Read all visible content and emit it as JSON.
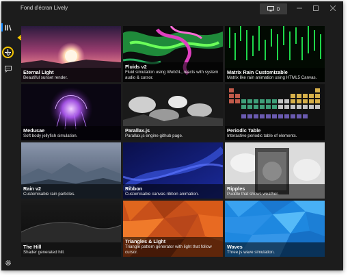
{
  "window": {
    "title": "Fond d'écran Lively",
    "display_button_label": "0",
    "icons": [
      "display-icon",
      "minimize-icon",
      "maximize-icon",
      "close-icon"
    ]
  },
  "sidebar": {
    "items": [
      {
        "name": "library-icon",
        "glyph": "║╲"
      },
      {
        "name": "add-icon",
        "glyph": "+"
      },
      {
        "name": "help-icon",
        "glyph": "?"
      },
      {
        "name": "feedback-icon",
        "glyph": "…"
      },
      {
        "name": "settings-icon",
        "glyph": "⚙"
      }
    ],
    "highlight_color": "#f7c600"
  },
  "wallpapers": [
    {
      "title": "Eternal Light",
      "description": "Beautiful sunset render."
    },
    {
      "title": "Fluids v2",
      "description": "Fluid simulation using WebGL, reacts with system audio & cursor."
    },
    {
      "title": "Matrix Rain Customizable",
      "description": "Matrix like rain animation using HTML5 Canvas."
    },
    {
      "title": "Medusae",
      "description": "Soft body jellyfish simulation."
    },
    {
      "title": "Parallax.js",
      "description": "Parallax.js engine github page."
    },
    {
      "title": "Periodic Table",
      "description": "Interactive periodic table of elements."
    },
    {
      "title": "Rain v2",
      "description": "Customisable rain particles."
    },
    {
      "title": "Ribbon",
      "description": "Customisable canvas ribbon animation."
    },
    {
      "title": "Ripples",
      "description": "Puddle that shows weather."
    },
    {
      "title": "The Hill",
      "description": "Shader generated hill."
    },
    {
      "title": "Triangles & Light",
      "description": "Triangle pattern generator with light that follow cursor."
    },
    {
      "title": "Waves",
      "description": "Three.js wave simulation."
    }
  ],
  "colors": {
    "accent": "#0a84ff",
    "window_bg": "#1c1c1c",
    "annotation": "#f7c600"
  }
}
